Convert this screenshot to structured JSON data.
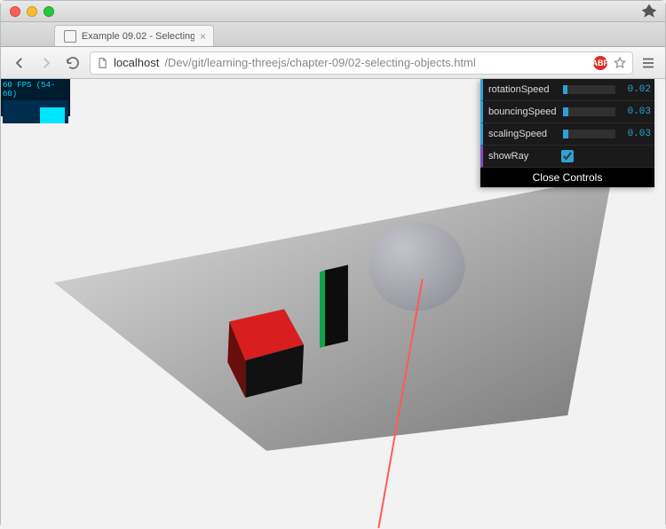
{
  "window": {
    "tab_title": "Example 09.02 - Selecting"
  },
  "url": {
    "host": "localhost",
    "path": "/Dev/git/learning-threejs/chapter-09/02-selecting-objects.html"
  },
  "abp": {
    "label": "ABP"
  },
  "stats": {
    "text": "60 FPS (54-60)"
  },
  "gui": {
    "rows": {
      "rotation": {
        "label": "rotationSpeed",
        "value": "0.02"
      },
      "bouncing": {
        "label": "bouncingSpeed",
        "value": "0.03"
      },
      "scaling": {
        "label": "scalingSpeed",
        "value": "0.03"
      },
      "showray": {
        "label": "showRay"
      }
    },
    "close": "Close Controls"
  },
  "scene": {
    "objects": [
      "ground-plane",
      "red-cube",
      "green-cylinder",
      "gray-sphere",
      "selection-ray"
    ]
  }
}
